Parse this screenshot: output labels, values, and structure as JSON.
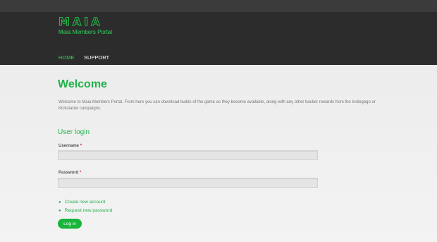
{
  "site": {
    "name": "MAIA",
    "slogan": "Maia Members Portal"
  },
  "nav": {
    "items": [
      {
        "label": "HOME"
      },
      {
        "label": "SUPPORT"
      }
    ]
  },
  "page": {
    "title": "Welcome",
    "intro": "Welcome to Maia Members Portal. From here you can download builds of the game as they become available, along with any other backer rewards from the Indiegogo or Kickstarter campaigns."
  },
  "login": {
    "heading": "User login",
    "username_label": "Username",
    "password_label": "Password",
    "required_marker": "*",
    "username_value": "",
    "password_value": "",
    "links": [
      {
        "label": "Create new account"
      },
      {
        "label": "Request new password"
      }
    ],
    "submit_label": "Log in"
  },
  "colors": {
    "accent": "#22b14c",
    "header_bg": "#2c2c2c",
    "topbar_bg": "#3b3b3b",
    "button_bg": "#18b53a"
  }
}
